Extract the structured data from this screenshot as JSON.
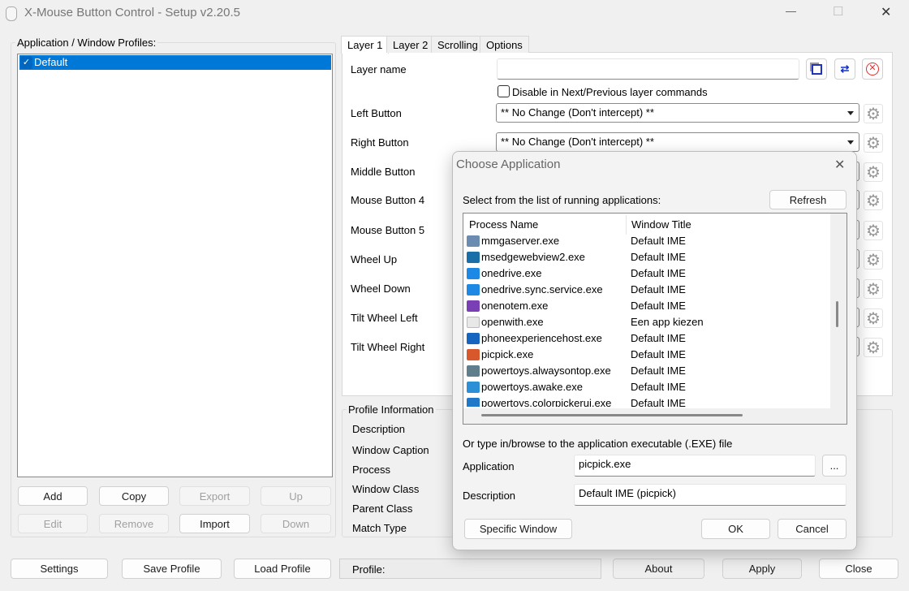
{
  "window": {
    "title": "X-Mouse Button Control - Setup v2.20.5",
    "minimize": "—",
    "maximize": "☐",
    "close": "✕"
  },
  "profiles": {
    "label": "Application / Window Profiles:",
    "items": [
      {
        "label": "Default",
        "checked": true
      }
    ],
    "buttons": {
      "add": "Add",
      "copy": "Copy",
      "export": "Export",
      "up": "Up",
      "edit": "Edit",
      "remove": "Remove",
      "import": "Import",
      "down": "Down"
    }
  },
  "tabs": [
    {
      "label": "Layer 1",
      "selected": true
    },
    {
      "label": "Layer 2"
    },
    {
      "label": "Scrolling"
    },
    {
      "label": "Options"
    }
  ],
  "layer": {
    "name_label": "Layer name",
    "name_value": "",
    "disable_label": "Disable in Next/Previous layer commands",
    "buttons": [
      {
        "label": "Left Button",
        "value": "** No Change (Don't intercept) **"
      },
      {
        "label": "Right Button",
        "value": "** No Change (Don't intercept) **"
      },
      {
        "label": "Middle Button"
      },
      {
        "label": "Mouse Button 4"
      },
      {
        "label": "Mouse Button 5"
      },
      {
        "label": "Wheel Up"
      },
      {
        "label": "Wheel Down"
      },
      {
        "label": "Tilt Wheel Left"
      },
      {
        "label": "Tilt Wheel Right"
      }
    ]
  },
  "profile_info": {
    "title": "Profile Information",
    "fields": [
      "Description",
      "Window Caption",
      "Process",
      "Window Class",
      "Parent Class",
      "Match Type"
    ]
  },
  "bottom": {
    "settings": "Settings",
    "save": "Save Profile",
    "load": "Load Profile",
    "profile_label": "Profile:",
    "about": "About",
    "apply": "Apply",
    "close": "Close"
  },
  "dialog": {
    "title": "Choose Application",
    "close": "✕",
    "select_label": "Select from the list of running applications:",
    "refresh": "Refresh",
    "columns": [
      "Process Name",
      "Window Title"
    ],
    "rows": [
      {
        "process": "mmgaserver.exe",
        "title": "Default IME",
        "icon": "app-window-icon",
        "color": "#6b8bb0"
      },
      {
        "process": "msedgewebview2.exe",
        "title": "Default IME",
        "icon": "edge-webview-icon",
        "color": "#1a6fa8"
      },
      {
        "process": "onedrive.exe",
        "title": "Default IME",
        "icon": "cloud-icon",
        "color": "#1e88e5"
      },
      {
        "process": "onedrive.sync.service.exe",
        "title": "Default IME",
        "icon": "cloud-icon",
        "color": "#1e88e5"
      },
      {
        "process": "onenotem.exe",
        "title": "Default IME",
        "icon": "onenote-icon",
        "color": "#7b3fb5"
      },
      {
        "process": "openwith.exe",
        "title": "Een app kiezen",
        "icon": "open-with-icon",
        "color": "#e8e8e8"
      },
      {
        "process": "phoneexperiencehost.exe",
        "title": "Default IME",
        "icon": "phone-link-icon",
        "color": "#1565c0"
      },
      {
        "process": "picpick.exe",
        "title": "Default IME",
        "icon": "picpick-icon",
        "color": "#d9582b"
      },
      {
        "process": "powertoys.alwaysontop.exe",
        "title": "Default IME",
        "icon": "powertoys-icon",
        "color": "#607d8b"
      },
      {
        "process": "powertoys.awake.exe",
        "title": "Default IME",
        "icon": "coffee-icon",
        "color": "#2d8fd5"
      },
      {
        "process": "powertoys.colorpickerui.exe",
        "title": "Default IME",
        "icon": "color-picker-icon",
        "color": "#1f78c8"
      }
    ],
    "browse_label": "Or type in/browse to the application executable (.EXE) file",
    "application_label": "Application",
    "application_value": "picpick.exe",
    "browse_button": "...",
    "description_label": "Description",
    "description_value": "Default IME (picpick)",
    "specific_window": "Specific Window",
    "ok": "OK",
    "cancel": "Cancel"
  },
  "colors": {
    "accent": "#0078d7"
  }
}
